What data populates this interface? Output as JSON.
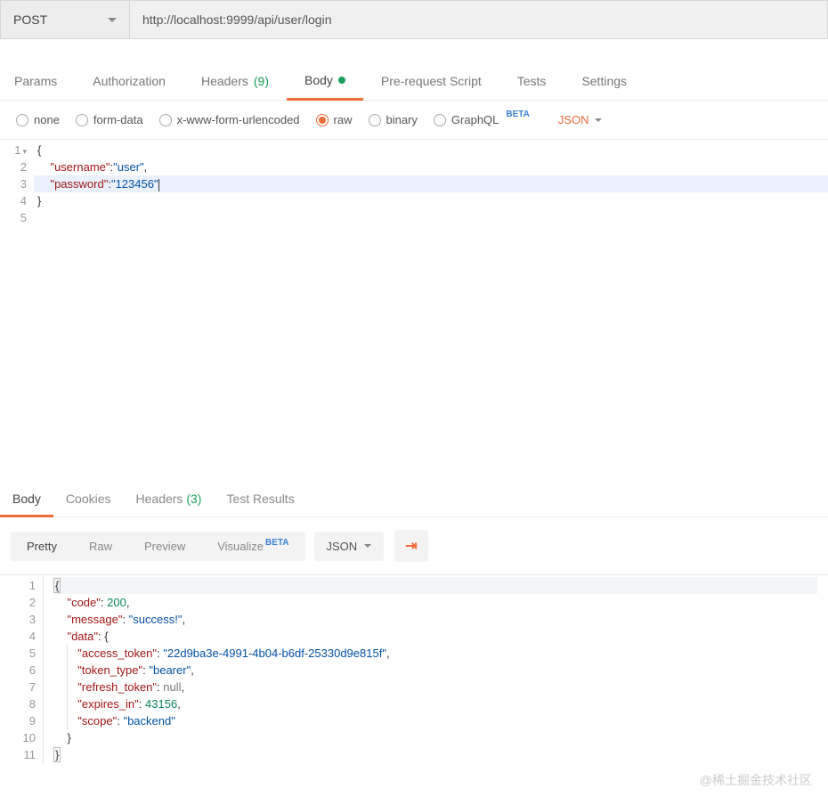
{
  "request": {
    "method": "POST",
    "url": "http://localhost:9999/api/user/login"
  },
  "tabs": {
    "params": "Params",
    "authorization": "Authorization",
    "headers": "Headers",
    "headers_count": "(9)",
    "body": "Body",
    "prerequest": "Pre-request Script",
    "tests": "Tests",
    "settings": "Settings"
  },
  "body_types": {
    "none": "none",
    "formdata": "form-data",
    "xwww": "x-www-form-urlencoded",
    "raw": "raw",
    "binary": "binary",
    "graphql": "GraphQL",
    "beta": "BETA",
    "lang": "JSON"
  },
  "req_body": {
    "l1": "{",
    "l2_key": "\"username\"",
    "l2_val": "\"user\"",
    "l3_key": "\"password\"",
    "l3_val": "\"123456\"",
    "l4": "}"
  },
  "req_gutter": [
    "1",
    "2",
    "3",
    "4",
    "5"
  ],
  "resp_tabs": {
    "body": "Body",
    "cookies": "Cookies",
    "headers": "Headers",
    "headers_count": "(3)",
    "tests": "Test Results"
  },
  "resp_tools": {
    "pretty": "Pretty",
    "raw": "Raw",
    "preview": "Preview",
    "visualize": "Visualize",
    "beta": "BETA",
    "lang": "JSON"
  },
  "resp_gutter": [
    "1",
    "2",
    "3",
    "4",
    "5",
    "6",
    "7",
    "8",
    "9",
    "10",
    "11"
  ],
  "resp": {
    "code_k": "\"code\"",
    "code_v": "200",
    "msg_k": "\"message\"",
    "msg_v": "\"success!\"",
    "data_k": "\"data\"",
    "at_k": "\"access_token\"",
    "at_v": "\"22d9ba3e-4991-4b04-b6df-25330d9e815f\"",
    "tt_k": "\"token_type\"",
    "tt_v": "\"bearer\"",
    "rt_k": "\"refresh_token\"",
    "rt_v": "null",
    "ei_k": "\"expires_in\"",
    "ei_v": "43156",
    "sc_k": "\"scope\"",
    "sc_v": "\"backend\""
  },
  "watermark": "@稀土掘金技术社区"
}
